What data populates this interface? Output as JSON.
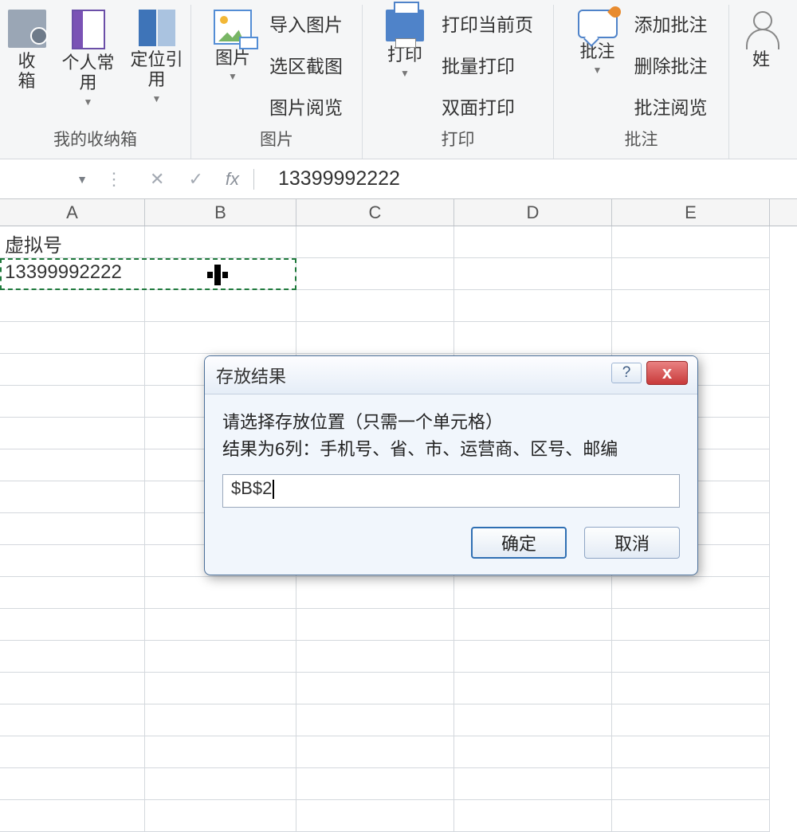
{
  "ribbon": {
    "group1": {
      "title": "我的收纳箱",
      "btn_toolbox": "收\n箱",
      "btn_personal": "个人常用",
      "btn_locate": "定位引用"
    },
    "group2": {
      "title": "图片",
      "btn_pic": "图片",
      "list": [
        "导入图片",
        "选区截图",
        "图片阅览"
      ]
    },
    "group3": {
      "title": "打印",
      "btn_print": "打印",
      "list": [
        "打印当前页",
        "批量打印",
        "双面打印"
      ]
    },
    "group4": {
      "title": "批注",
      "btn_comment": "批注",
      "list": [
        "添加批注",
        "删除批注",
        "批注阅览"
      ]
    },
    "group5": {
      "btn_name": "姓"
    }
  },
  "formula_bar": {
    "fx": "fx",
    "value": "13399992222"
  },
  "grid": {
    "cols": [
      "A",
      "B",
      "C",
      "D",
      "E"
    ],
    "A1": "虚拟号",
    "A2": "13399992222"
  },
  "dialog": {
    "title": "存放结果",
    "line1": "请选择存放位置（只需一个单元格）",
    "line2": "结果为6列：手机号、省、市、运营商、区号、邮编",
    "input_value": "$B$2",
    "ok": "确定",
    "cancel": "取消",
    "help": "?",
    "close": "x"
  }
}
